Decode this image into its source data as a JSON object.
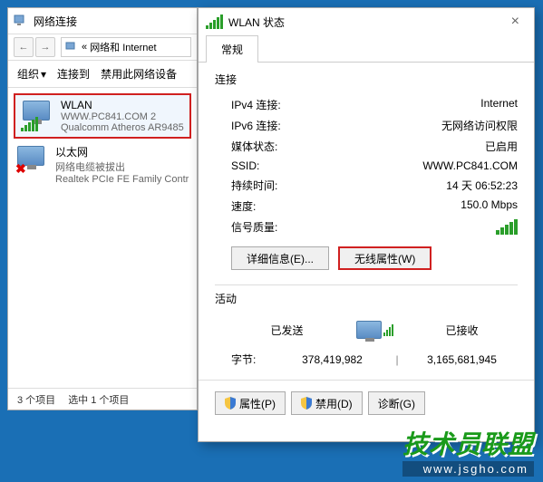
{
  "explorer": {
    "title": "网络连接",
    "breadcrumb_prefix": "«",
    "breadcrumb": "网络和 Internet",
    "toolbar": {
      "organize": "组织",
      "connect": "连接到",
      "disable": "禁用此网络设备"
    },
    "items": [
      {
        "name": "WLAN",
        "sub1": "WWW.PC841.COM  2",
        "sub2": "Qualcomm Atheros AR9485",
        "selected": true,
        "signal": true
      },
      {
        "name": "以太网",
        "sub1": "网络电缆被拔出",
        "sub2": "Realtek PCIe FE Family Contr",
        "selected": false,
        "disconnected": true
      }
    ],
    "status": {
      "count": "3 个项目",
      "selected": "选中 1 个项目"
    }
  },
  "dialog": {
    "title": "WLAN 状态",
    "tab": "常规",
    "close": "×",
    "connection": {
      "label": "连接",
      "ipv4_k": "IPv4 连接:",
      "ipv4_v": "Internet",
      "ipv6_k": "IPv6 连接:",
      "ipv6_v": "无网络访问权限",
      "media_k": "媒体状态:",
      "media_v": "已启用",
      "ssid_k": "SSID:",
      "ssid_v": "WWW.PC841.COM",
      "duration_k": "持续时间:",
      "duration_v": "14 天 06:52:23",
      "speed_k": "速度:",
      "speed_v": "150.0 Mbps",
      "quality_k": "信号质量:"
    },
    "buttons": {
      "details": "详细信息(E)...",
      "wireless_props": "无线属性(W)"
    },
    "activity": {
      "label": "活动",
      "sent": "已发送",
      "received": "已接收",
      "bytes_k": "字节:",
      "bytes_sent": "378,419,982",
      "bytes_recv": "3,165,681,945"
    },
    "footer": {
      "props": "属性(P)",
      "disable": "禁用(D)",
      "diagnose": "诊断(G)"
    }
  },
  "watermark": {
    "text": "技术员联盟",
    "url": "www.jsgho.com"
  }
}
